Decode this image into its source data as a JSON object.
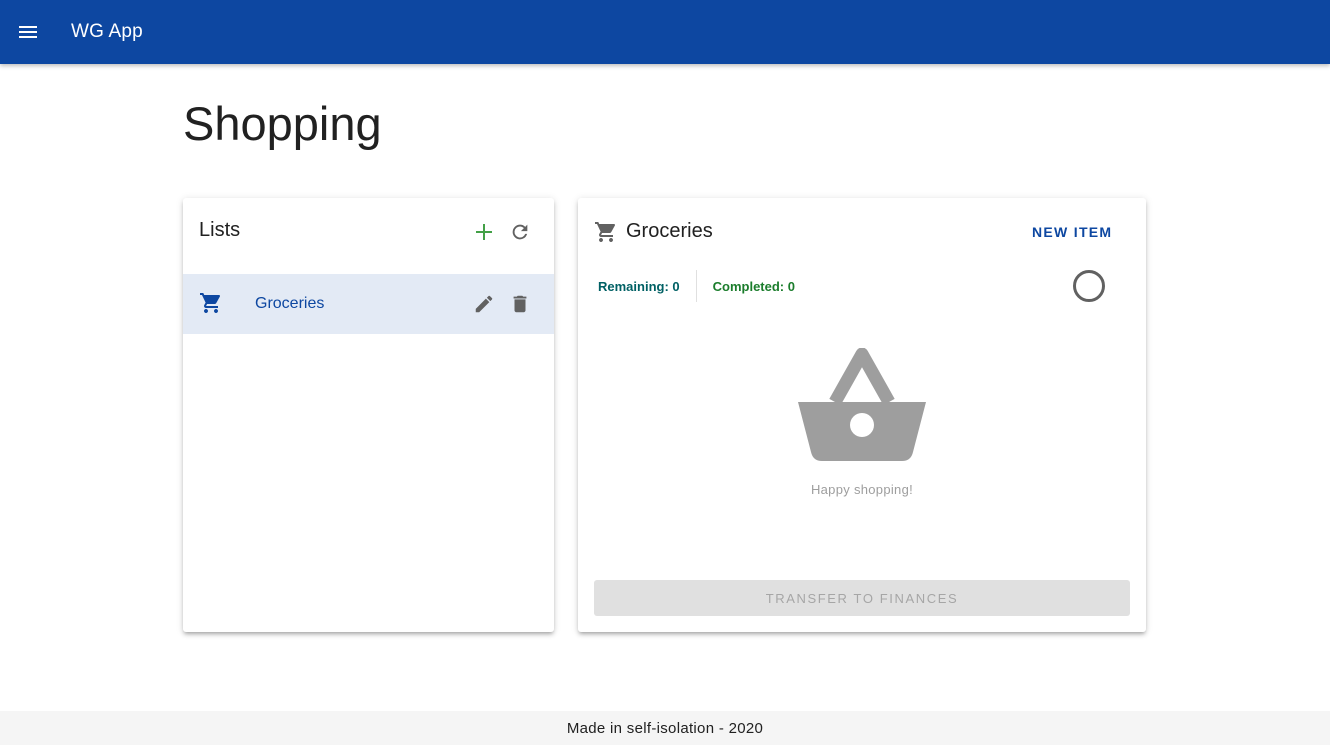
{
  "app": {
    "title": "WG App",
    "menu_icon": "menu-icon"
  },
  "page": {
    "title": "Shopping"
  },
  "lists": {
    "title": "Lists",
    "add_icon": "plus-icon",
    "refresh_icon": "refresh-icon",
    "items": [
      {
        "label": "Groceries",
        "icon": "cart-icon",
        "edit_icon": "pencil-icon",
        "delete_icon": "trash-icon",
        "selected": true
      }
    ]
  },
  "detail": {
    "title": "Groceries",
    "icon": "cart-icon",
    "new_item_label": "NEW ITEM",
    "remaining_label": "Remaining: 0",
    "completed_label": "Completed: 0",
    "progress": 0,
    "empty_icon": "basket-icon",
    "empty_text": "Happy shopping!",
    "transfer_label": "TRANSFER TO FINANCES"
  },
  "footer": {
    "text": "Made in self-isolation - 2020"
  },
  "colors": {
    "primary": "#0d47a1",
    "add_green": "#43a047",
    "remaining": "#006064",
    "completed": "#1b7d2c",
    "selected_row": "#e3eaf5"
  }
}
